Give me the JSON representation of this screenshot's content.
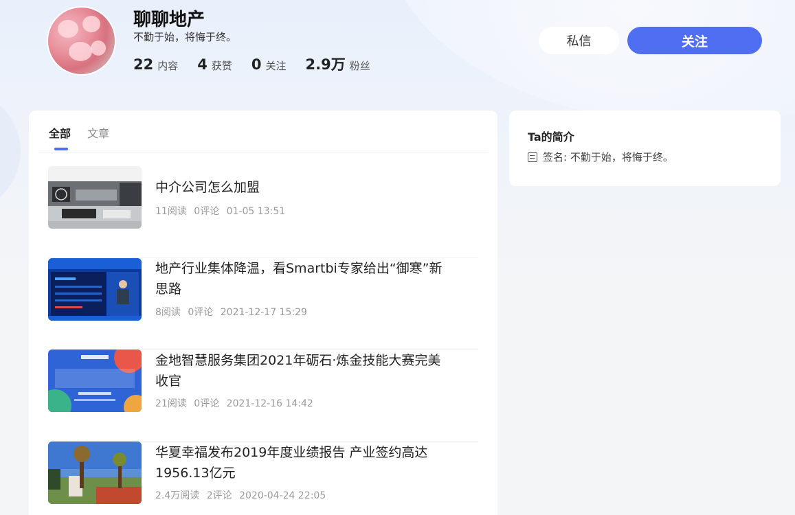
{
  "profile": {
    "name": "聊聊地产",
    "motto": "不勤于始，将悔于终。",
    "stats": [
      {
        "value": "22",
        "label": "内容"
      },
      {
        "value": "4",
        "label": "获赞"
      },
      {
        "value": "0",
        "label": "关注"
      },
      {
        "value": "2.9万",
        "label": "粉丝"
      }
    ]
  },
  "actions": {
    "message_label": "私信",
    "follow_label": "关注"
  },
  "tabs": [
    {
      "label": "全部",
      "active": true
    },
    {
      "label": "文章",
      "active": false
    }
  ],
  "articles": [
    {
      "title": "中介公司怎么加盟",
      "reads": "11阅读",
      "comments": "0评论",
      "time": "01-05 13:51"
    },
    {
      "title": "地产行业集体降温，看Smartbi专家给出“御寒”新思路",
      "reads": "8阅读",
      "comments": "0评论",
      "time": "2021-12-17 15:29"
    },
    {
      "title": "金地智慧服务集团2021年砺石·炼金技能大赛完美收官",
      "reads": "21阅读",
      "comments": "0评论",
      "time": "2021-12-16 14:42"
    },
    {
      "title": "华夏幸福发布2019年度业绩报告 产业签约高达1956.13亿元",
      "reads": "2.4万阅读",
      "comments": "2评论",
      "time": "2020-04-24 22:05"
    }
  ],
  "sidebar": {
    "title": "Ta的简介",
    "sign_label": "签名: 不勤于始，将悔于终。"
  },
  "colors": {
    "accent": "#4f6ef2",
    "background": "#f4f5f7",
    "card": "#ffffff"
  }
}
